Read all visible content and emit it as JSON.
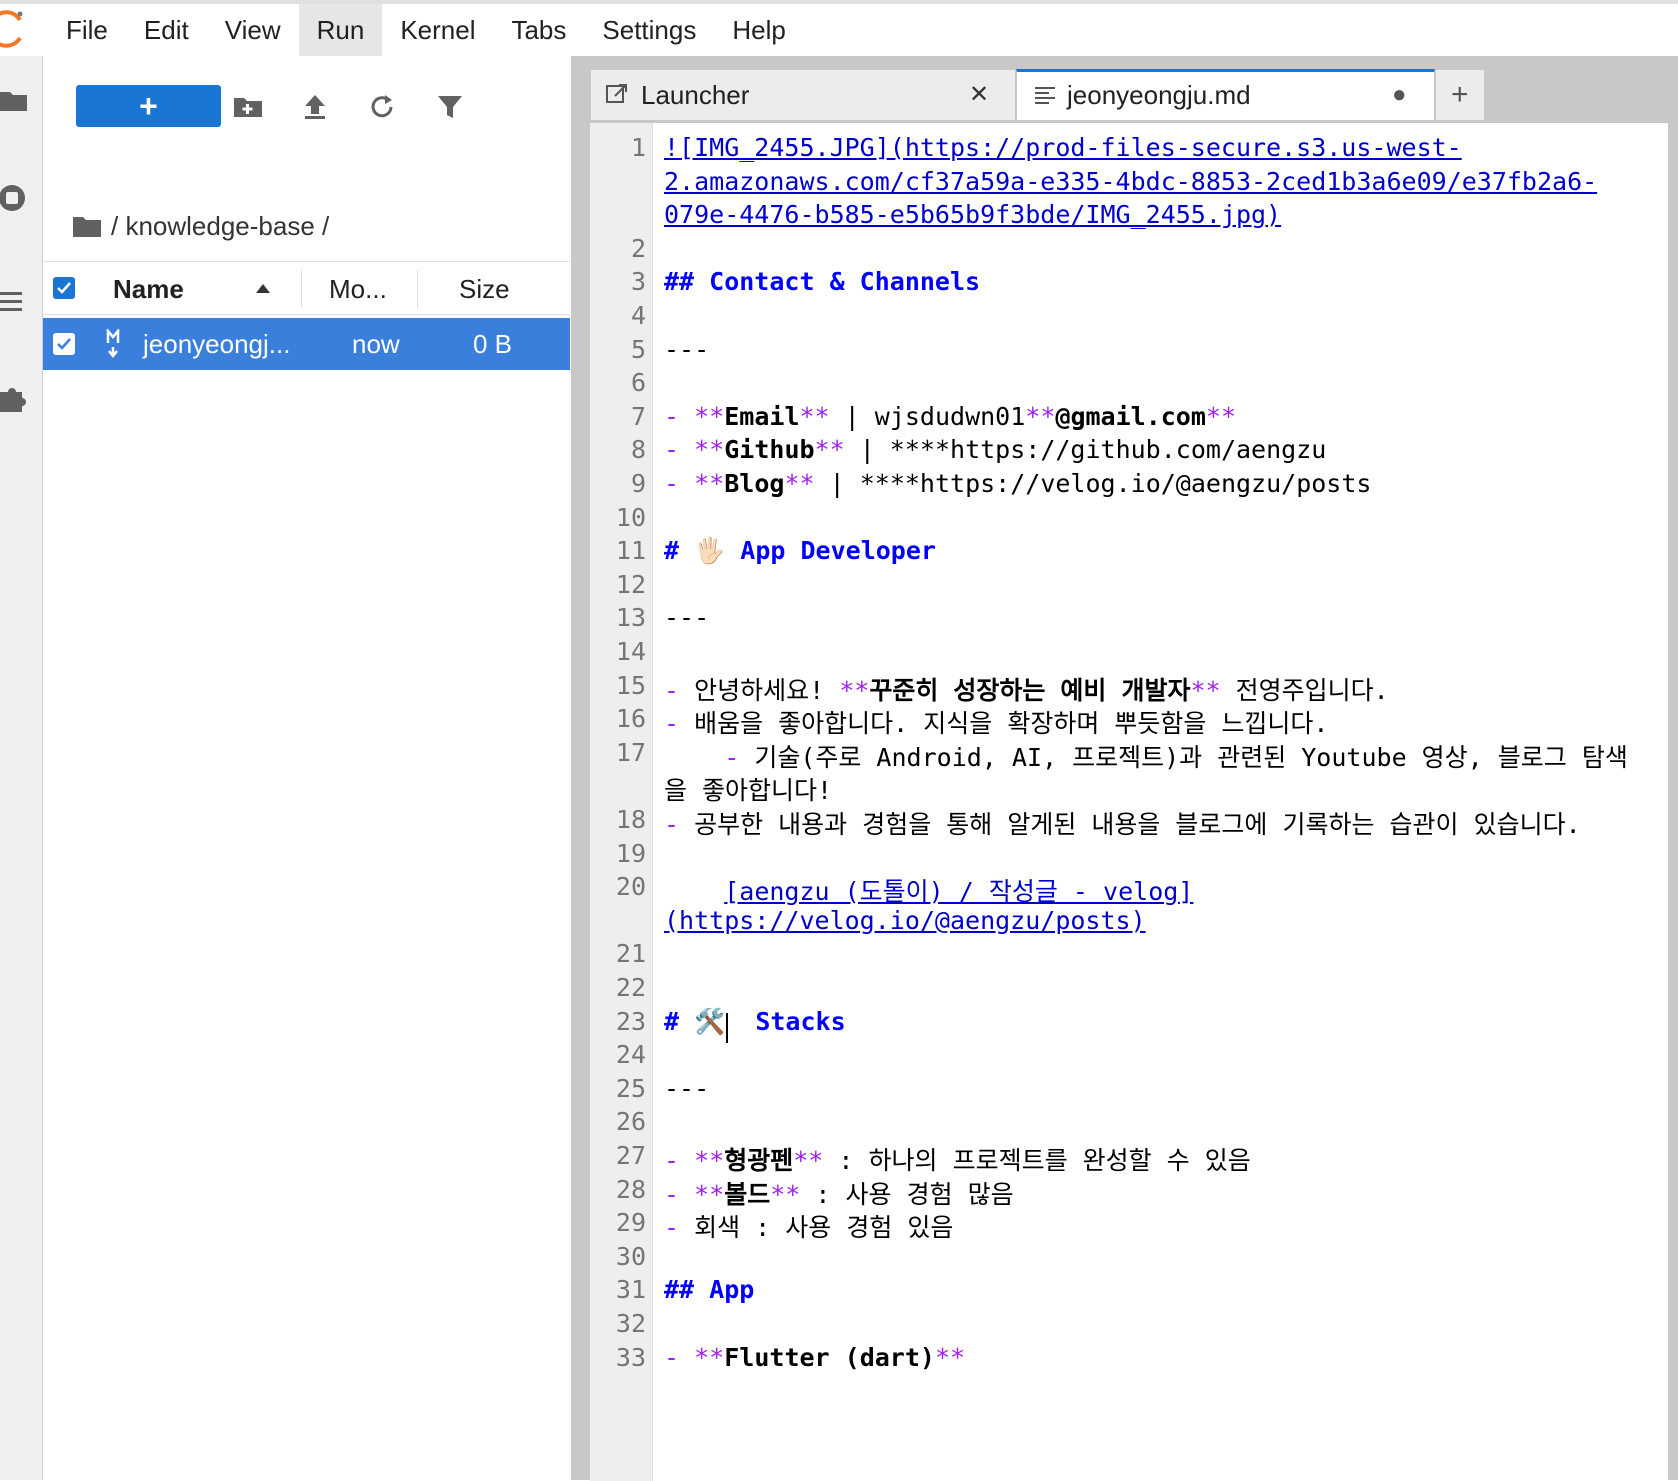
{
  "menu": [
    "File",
    "Edit",
    "View",
    "Run",
    "Kernel",
    "Tabs",
    "Settings",
    "Help"
  ],
  "menu_active": "Run",
  "filebrowser": {
    "new_label": "+",
    "breadcrumb": "/ knowledge-base /",
    "columns": {
      "name": "Name",
      "modified": "Mo...",
      "size": "Size"
    },
    "files": [
      {
        "name": "jeonyeongj...",
        "modified": "now",
        "size": "0 B"
      }
    ]
  },
  "tabs": [
    {
      "label": "Launcher",
      "icon": "launcher-icon",
      "close": "✕"
    },
    {
      "label": "jeonyeongju.md",
      "icon": "text-file-icon",
      "dirty": "●"
    }
  ],
  "new_tab_label": "+",
  "editor": {
    "lines": [
      {
        "n": "1",
        "text": "![IMG_2455.JPG](https://prod-files-secure.s3.us-west-"
      },
      {
        "n": "",
        "text": "2.amazonaws.com/cf37a59a-e335-4bdc-8853-2ced1b3a6e09/e37fb2a6-"
      },
      {
        "n": "",
        "text": "079e-4476-b585-e5b65b9f3bde/IMG_2455.jpg)"
      },
      {
        "n": "2",
        "text": ""
      },
      {
        "n": "3",
        "text": "## Contact & Channels"
      },
      {
        "n": "4",
        "text": ""
      },
      {
        "n": "5",
        "text": "---"
      },
      {
        "n": "6",
        "text": ""
      },
      {
        "n": "7",
        "text": "- **Email** | wjsdudwn01**@gmail.com**"
      },
      {
        "n": "8",
        "text": "- **Github** | ****https://github.com/aengzu"
      },
      {
        "n": "9",
        "text": "- **Blog** | ****https://velog.io/@aengzu/posts"
      },
      {
        "n": "10",
        "text": ""
      },
      {
        "n": "11",
        "text": "# 🖐🏻 App Developer"
      },
      {
        "n": "12",
        "text": ""
      },
      {
        "n": "13",
        "text": "---"
      },
      {
        "n": "14",
        "text": ""
      },
      {
        "n": "15",
        "text": "- 안녕하세요! **꾸준히 성장하는 예비 개발자** 전영주입니다."
      },
      {
        "n": "16",
        "text": "- 배움을 좋아합니다. 지식을 확장하며 뿌듯함을 느낍니다."
      },
      {
        "n": "17",
        "text": "    - 기술(주로 Android, AI, 프로젝트)과 관련된 Youtube 영상, 블로그 탐색"
      },
      {
        "n": "",
        "text": "을 좋아합니다!"
      },
      {
        "n": "18",
        "text": "- 공부한 내용과 경험을 통해 알게된 내용을 블로그에 기록하는 습관이 있습니다."
      },
      {
        "n": "19",
        "text": ""
      },
      {
        "n": "20",
        "text": "    [aengzu (도톨이) / 작성글 - velog]"
      },
      {
        "n": "",
        "text": "(https://velog.io/@aengzu/posts)"
      },
      {
        "n": "21",
        "text": ""
      },
      {
        "n": "22",
        "text": ""
      },
      {
        "n": "23",
        "text": "# 🛠️  Stacks"
      },
      {
        "n": "24",
        "text": ""
      },
      {
        "n": "25",
        "text": "---"
      },
      {
        "n": "26",
        "text": ""
      },
      {
        "n": "27",
        "text": "- **형광펜** : 하나의 프로젝트를 완성할 수 있음"
      },
      {
        "n": "28",
        "text": "- **볼드** : 사용 경험 많음"
      },
      {
        "n": "29",
        "text": "- 회색 : 사용 경험 있음"
      },
      {
        "n": "30",
        "text": ""
      },
      {
        "n": "31",
        "text": "## App"
      },
      {
        "n": "32",
        "text": ""
      },
      {
        "n": "33",
        "text": "- **Flutter (dart)**"
      }
    ]
  },
  "colors": {
    "accent": "#1976d2",
    "selected_row": "#3a7fdb",
    "link": "#0000cc",
    "header": "#0000ff",
    "markup": "#a020f0"
  }
}
